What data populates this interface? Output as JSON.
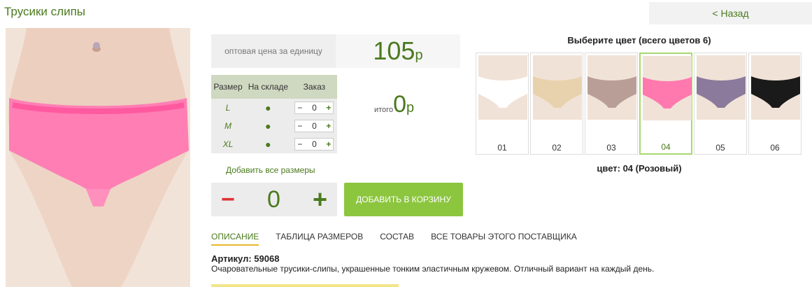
{
  "header": {
    "title": "Трусики слипы",
    "back_label": "< Назад"
  },
  "price": {
    "label": "оптовая цена за единицу",
    "value": "105",
    "currency": "р"
  },
  "sizes_table": {
    "headers": [
      "Размер",
      "На складе",
      "Заказ"
    ],
    "rows": [
      {
        "size": "L",
        "stock": "●",
        "qty": "0"
      },
      {
        "size": "M",
        "stock": "●",
        "qty": "0"
      },
      {
        "size": "XL",
        "stock": "●",
        "qty": "0"
      }
    ]
  },
  "total": {
    "label": "итого",
    "value": "0",
    "currency": "р"
  },
  "add_all_label": "Добавить все размеры",
  "quantity": {
    "minus": "−",
    "value": "0",
    "plus": "+"
  },
  "cart_button": "ДОБАВИТЬ В КОРЗИНУ",
  "tabs": [
    {
      "label": "ОПИСАНИЕ",
      "active": true
    },
    {
      "label": "ТАБЛИЦА РАЗМЕРОВ",
      "active": false
    },
    {
      "label": "СОСТАВ",
      "active": false
    },
    {
      "label": "ВСЕ ТОВАРЫ ЭТОГО ПОСТАВЩИКА",
      "active": false
    }
  ],
  "article": {
    "label": "Артикул:",
    "value": "59068"
  },
  "description": "Очаровательные трусики-слипы, украшенные тонким эластичным кружевом. Отличный вариант на каждый день.",
  "colors": {
    "heading": "Выберите цвет (всего цветов 6)",
    "items": [
      {
        "code": "01",
        "color": "#ffffff"
      },
      {
        "code": "02",
        "color": "#e8d2ad"
      },
      {
        "code": "03",
        "color": "#b99e98"
      },
      {
        "code": "04",
        "color": "#ff79ae"
      },
      {
        "code": "05",
        "color": "#8b7a9b"
      },
      {
        "code": "06",
        "color": "#1a1a1a"
      }
    ],
    "selected_text": "цвет: 04 (Розовый)"
  },
  "accent_colors": {
    "brand_green": "#4a7a1e",
    "button_green": "#8cc63f",
    "minus_red": "#e03131"
  }
}
